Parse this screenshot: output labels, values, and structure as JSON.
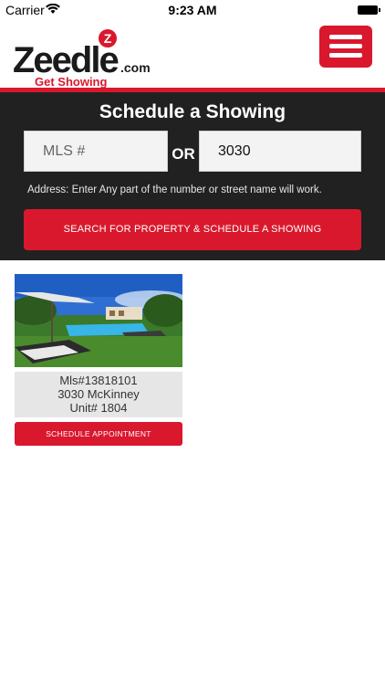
{
  "status_bar": {
    "carrier": "Carrier",
    "time": "9:23 AM"
  },
  "header": {
    "logo_word": "Zeedle",
    "logo_suffix": ".com",
    "logo_badge": "Z",
    "logo_tagline": "Get Showing"
  },
  "search": {
    "title": "Schedule a Showing",
    "mls_placeholder": "MLS #",
    "or_label": "OR",
    "address_value": "3030",
    "hint": "Address: Enter Any part of the number or street name will work.",
    "button_label": "SEARCH FOR PROPERTY & SCHEDULE A SHOWING"
  },
  "listings": [
    {
      "mls": "Mls#13818101",
      "street": "3030 McKinney",
      "unit": "Unit# 1804",
      "button_label": "SCHEDULE APPOINTMENT"
    }
  ],
  "colors": {
    "brand_red": "#d9182d",
    "panel_dark": "#212121"
  }
}
